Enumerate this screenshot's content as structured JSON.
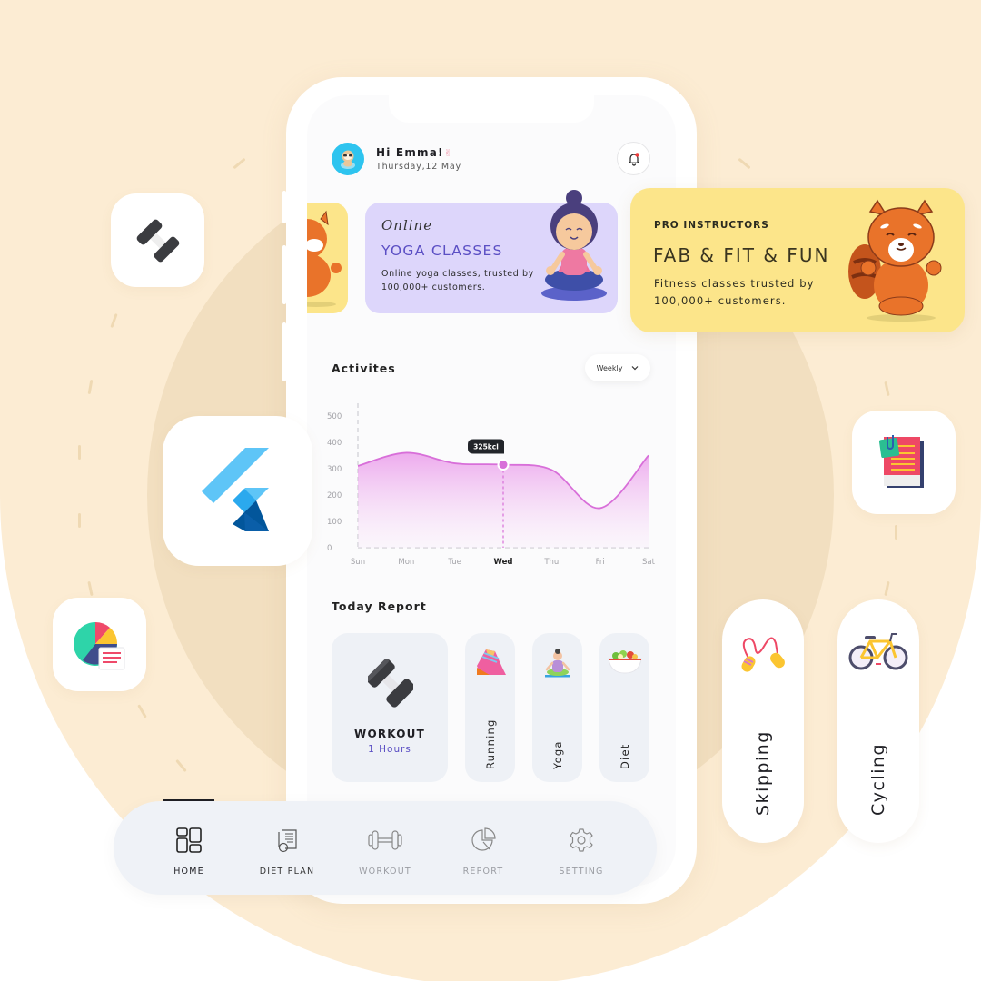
{
  "header": {
    "greeting": "Hi Emma!",
    "greeting_emoji": "✌",
    "date": "Thursday,12 May",
    "avatar_icon": "sloth-avatar-icon",
    "notification_icon": "bell-icon"
  },
  "banners": [
    {
      "id": "yoga",
      "kicker": "Online",
      "title": "YOGA CLASSES",
      "description": "Online yoga classes, trusted by 100,000+ customers.",
      "color": "#DDD6FB",
      "accent": "#5B4FC4"
    },
    {
      "id": "pro",
      "kicker": "PRO INSTRUCTORS",
      "title": "FAB & FIT & FUN",
      "description": "Fitness classes trusted by 100,000+ customers.",
      "color": "#FCE58A"
    }
  ],
  "activities": {
    "title": "Activites",
    "period_select": "Weekly",
    "tooltip": "325kcl"
  },
  "chart_data": {
    "type": "area",
    "title": "Activites",
    "categories": [
      "Sun",
      "Mon",
      "Tue",
      "Wed",
      "Thu",
      "Fri",
      "Sat"
    ],
    "highlighted_category": "Wed",
    "series": [
      {
        "name": "kcal",
        "values": [
          310,
          360,
          320,
          315,
          295,
          150,
          350
        ],
        "color": "#D86FD9"
      }
    ],
    "yticks": [
      0,
      100,
      200,
      300,
      400,
      500
    ],
    "ylim": [
      0,
      520
    ],
    "annotation": {
      "category": "Wed",
      "label": "325kcl"
    },
    "grid": false,
    "xlabel": "",
    "ylabel": ""
  },
  "today_report": {
    "title": "Today Report",
    "workout": {
      "label": "WORKOUT",
      "value": "1 Hours"
    },
    "items": [
      {
        "label": "Running",
        "icon": "running-shoe-icon"
      },
      {
        "label": "Yoga",
        "icon": "yoga-pose-icon"
      },
      {
        "label": "Diet",
        "icon": "salad-bowl-icon"
      }
    ]
  },
  "nav": {
    "items": [
      {
        "label": "HOME",
        "icon": "home-grid-icon",
        "active": true
      },
      {
        "label": "DIET PLAN",
        "icon": "diet-plan-icon"
      },
      {
        "label": "WORKOUT",
        "icon": "dumbbell-icon"
      },
      {
        "label": "REPORT",
        "icon": "pie-chart-icon"
      },
      {
        "label": "SETTING",
        "icon": "gear-icon"
      }
    ]
  },
  "floating": {
    "pills": [
      {
        "label": "Skipping",
        "icon": "jump-rope-icon"
      },
      {
        "label": "Cycling",
        "icon": "bicycle-icon"
      }
    ],
    "tiles": [
      "dumbbell-icon",
      "flutter-logo-icon",
      "pie-report-icon",
      "notes-clip-icon"
    ]
  }
}
